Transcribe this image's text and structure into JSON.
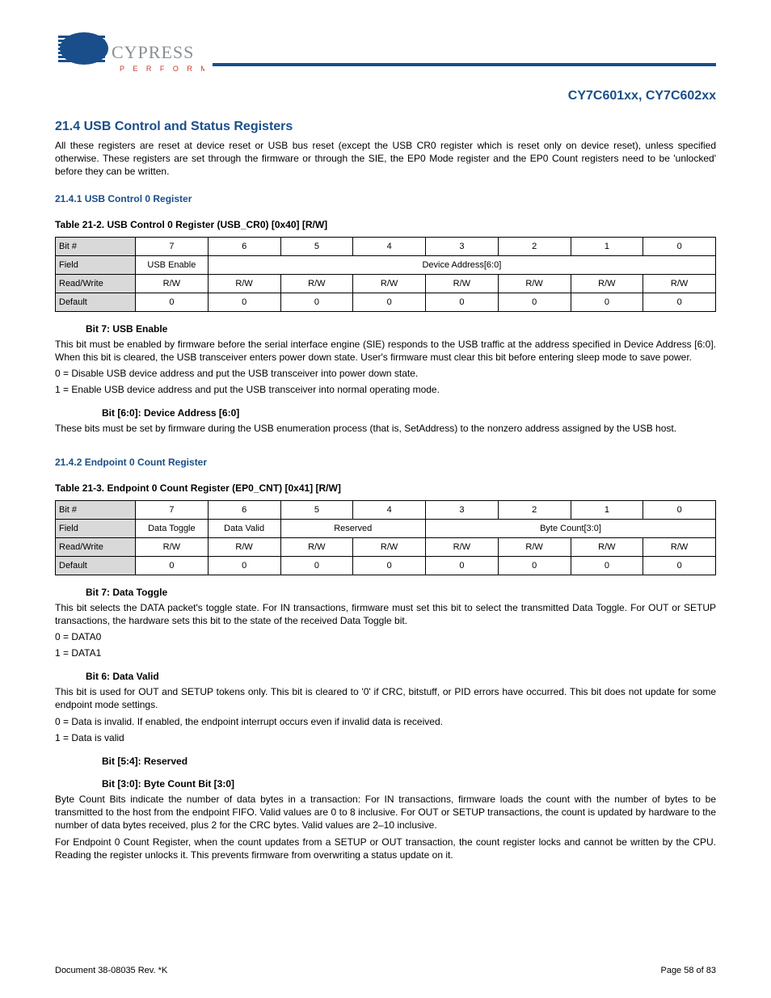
{
  "header": {
    "logo_text": "CYPRESS",
    "logo_subtext": "P E R F O R M",
    "device_id": "CY7C601xx, CY7C602xx"
  },
  "sections": {
    "top_title": "21.4 USB Control and Status Registers",
    "top_intro": "All these registers are reset at device reset or USB bus reset (except the USB CR0 register which is reset only on device reset), unless specified otherwise. These registers are set through the firmware or through the SIE, the EP0 Mode register and the EP0 Count registers need to be 'unlocked' before they can be written.",
    "reg1_title": "21.4.1 USB Control 0 Register",
    "reg1_name": "Table 21-2.  USB Control 0 Register (USB_CR0) [0x40] [R/W]",
    "reg2_title": "21.4.2 Endpoint 0 Count Register",
    "reg2_name": "Table 21-3.  Endpoint 0 Count Register (EP0_CNT) [0x41] [R/W]"
  },
  "table1": {
    "rows": {
      "bitnum": [
        "Bit #",
        "7",
        "6",
        "5",
        "4",
        "3",
        "2",
        "1",
        "0"
      ],
      "field": [
        "Field",
        "USB Enable",
        "Device Address[6:0]"
      ],
      "rw": [
        "Read/Write",
        "R/W",
        "R/W",
        "R/W",
        "R/W",
        "R/W",
        "R/W",
        "R/W",
        "R/W"
      ],
      "default": [
        "Default",
        "0",
        "0",
        "0",
        "0",
        "0",
        "0",
        "0",
        "0"
      ]
    }
  },
  "table2": {
    "rows": {
      "bitnum": [
        "Bit #",
        "7",
        "6",
        "5",
        "4",
        "3",
        "2",
        "1",
        "0"
      ],
      "field": [
        "Field",
        "Data Toggle",
        "Data Valid",
        "Reserved",
        "Byte Count[3:0]"
      ],
      "rw": [
        "Read/Write",
        "R/W",
        "R/W",
        "R/W",
        "R/W",
        "R/W",
        "R/W",
        "R/W",
        "R/W"
      ],
      "default": [
        "Default",
        "0",
        "0",
        "0",
        "0",
        "0",
        "0",
        "0",
        "0"
      ]
    }
  },
  "body": {
    "t1": {
      "bit7_lbl": "Bit 7:  USB Enable",
      "bit7_p1": "This bit must be enabled by firmware before the serial interface engine (SIE) responds to the USB traffic at the address specified in Device Address [6:0]. When this bit is cleared, the USB transceiver enters power down state. User's firmware must clear this bit before entering sleep mode to save power.",
      "bit7_v0": "0 = Disable USB device address and put the USB transceiver into power down state.",
      "bit7_v1": "1 = Enable USB device address and put the USB transceiver into normal operating mode.",
      "bit60_lbl": "Bit [6:0]:  Device Address [6:0]",
      "bit60_p": "These bits must be set by firmware during the USB enumeration process (that is, SetAddress) to the nonzero address assigned by the USB host."
    },
    "t2": {
      "bit7_lbl": "Bit 7:  Data Toggle",
      "bit7_p": "This bit selects the DATA packet's toggle state. For IN transactions, firmware must set this bit to select the transmitted Data Toggle. For OUT or SETUP transactions, the hardware sets this bit to the state of the received Data Toggle bit.",
      "bit7_v0": "0 = DATA0",
      "bit7_v1": "1 = DATA1",
      "bit6_lbl": "Bit 6:  Data Valid",
      "bit6_p": "This bit is used for OUT and SETUP tokens only. This bit is cleared to '0' if CRC, bitstuff, or PID errors have occurred. This bit does not update for some endpoint mode settings.",
      "bit6_v0": "0 = Data is invalid. If enabled, the endpoint interrupt occurs even if invalid data is received.",
      "bit6_v1": "1 = Data is valid",
      "bit54_lbl": "Bit [5:4]:  Reserved",
      "bit30_lbl": "Bit [3:0]:  Byte Count Bit [3:0]",
      "bit30_p1": "Byte Count Bits indicate the number of data bytes in a transaction: For IN transactions, firmware loads the count with the number of bytes to be transmitted to the host from the endpoint FIFO. Valid values are 0 to 8 inclusive. For OUT or SETUP transactions, the count is updated by hardware to the number of data bytes received, plus 2 for the CRC bytes. Valid values are 2–10 inclusive.",
      "bit30_p2": "For Endpoint 0 Count Register, when the count updates from a SETUP or OUT transaction, the count register locks and cannot be written by the CPU. Reading the register unlocks it. This prevents firmware from overwriting a status update on it."
    }
  },
  "footer": {
    "left": "Document 38-08035 Rev. *K",
    "right": "Page 58 of 83"
  }
}
